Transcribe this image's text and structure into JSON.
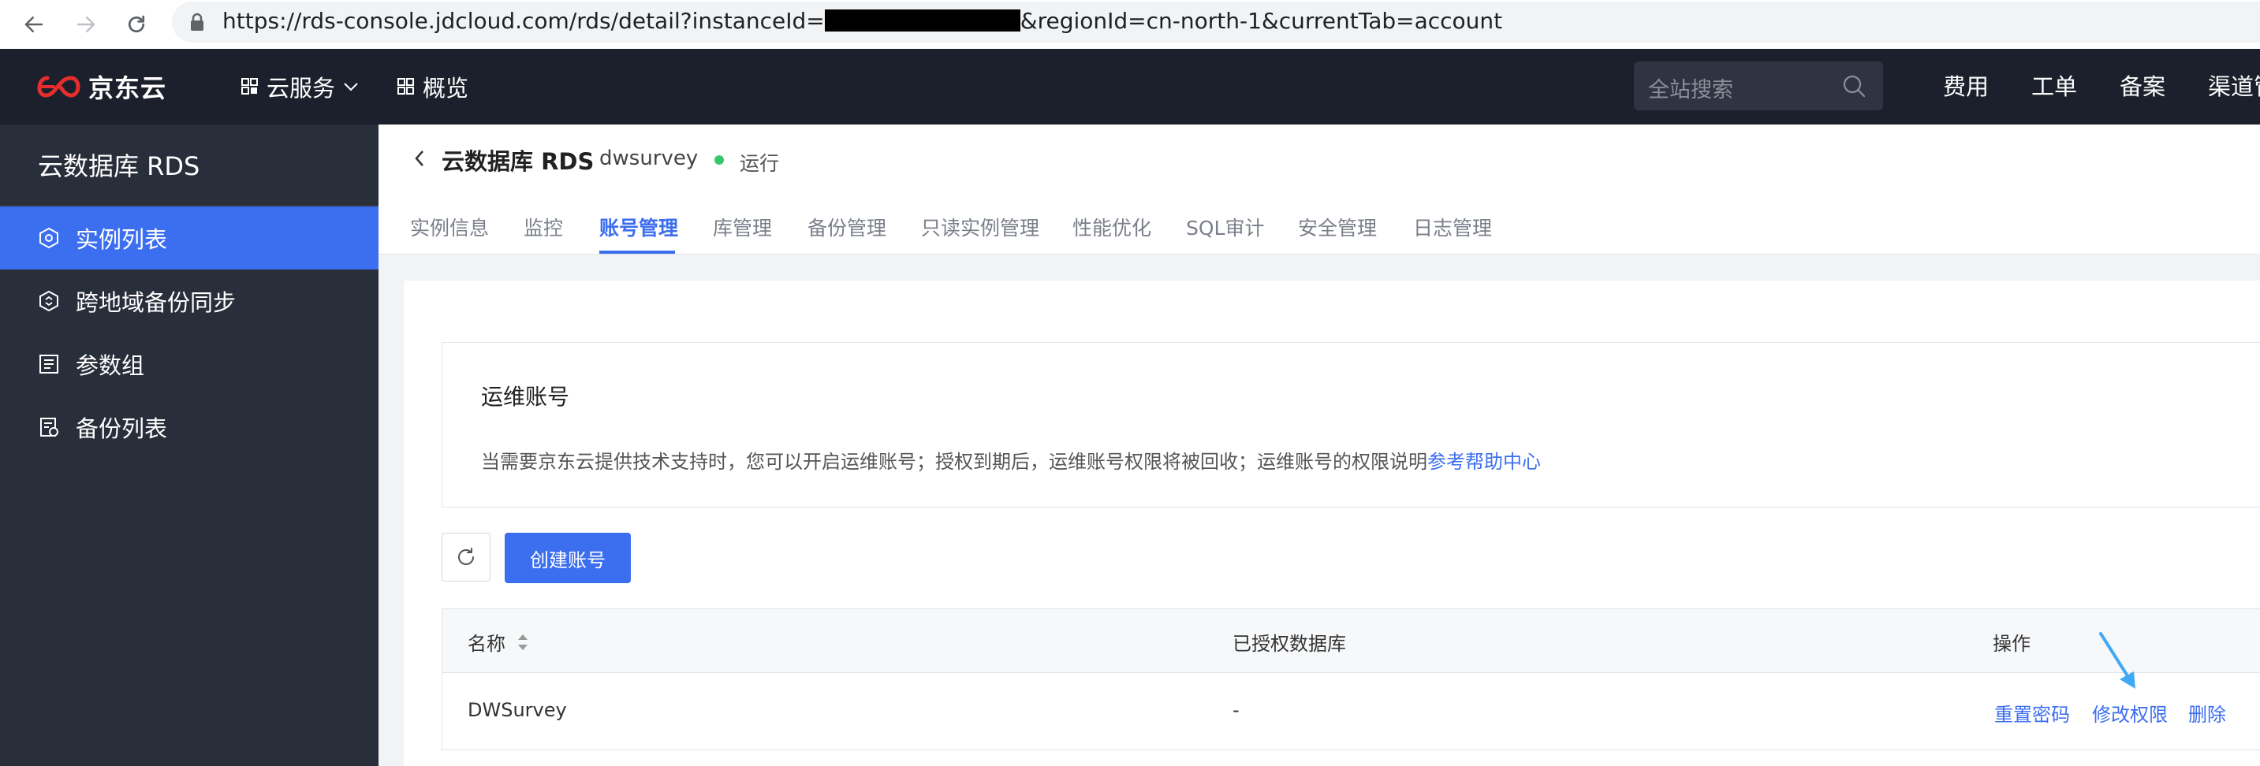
{
  "browser": {
    "url_prefix": "https://rds-console.jdcloud.com/rds/detail?instanceId=",
    "url_suffix": "&regionId=cn-north-1&currentTab=account"
  },
  "topnav": {
    "logo_text": "京东云",
    "cloud_services": "云服务",
    "overview": "概览",
    "search_placeholder": "全站搜索",
    "right_links": [
      "费用",
      "工单",
      "备案",
      "渠道管"
    ]
  },
  "sidebar": {
    "title": "云数据库 RDS",
    "items": [
      {
        "label": "实例列表",
        "icon": "instance-icon",
        "active": true
      },
      {
        "label": "跨地域备份同步",
        "icon": "sync-icon",
        "active": false
      },
      {
        "label": "参数组",
        "icon": "params-icon",
        "active": false
      },
      {
        "label": "备份列表",
        "icon": "backup-icon",
        "active": false
      }
    ]
  },
  "header": {
    "title": "云数据库 RDS",
    "instance_name": "dwsurvey",
    "status": "运行",
    "status_color": "#36c76c",
    "tabs": [
      "实例信息",
      "监控",
      "账号管理",
      "库管理",
      "备份管理",
      "只读实例管理",
      "性能优化",
      "SQL审计",
      "安全管理",
      "日志管理"
    ],
    "active_tab": "账号管理"
  },
  "ops_account": {
    "title": "运维账号",
    "description": "当需要京东云提供技术支持时，您可以开启运维账号；授权到期后，运维账号权限将被回收；运维账号的权限说明",
    "help_link": "参考帮助中心"
  },
  "toolbar": {
    "create_label": "创建账号"
  },
  "table": {
    "columns": [
      "名称",
      "已授权数据库",
      "操作"
    ],
    "rows": [
      {
        "name": "DWSurvey",
        "databases": "-",
        "actions": [
          "重置密码",
          "修改权限",
          "删除"
        ]
      }
    ]
  },
  "colors": {
    "accent": "#3c6ef0",
    "topnav_bg": "#1b202c",
    "sidebar_bg": "#292e3b",
    "annotation_arrow": "#3fa9f5"
  }
}
